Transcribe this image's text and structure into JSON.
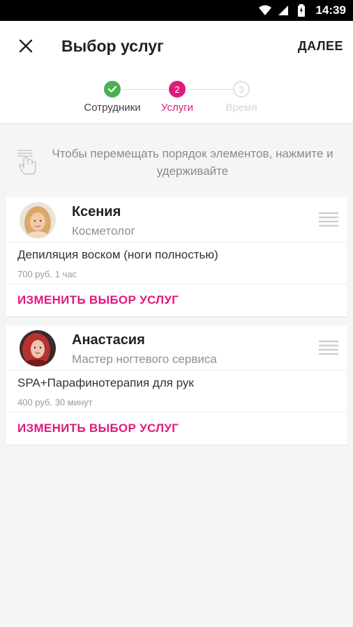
{
  "status_bar": {
    "time": "14:39",
    "icons": [
      "wifi-icon",
      "signal-icon",
      "battery-icon"
    ]
  },
  "app_bar": {
    "title": "Выбор услуг",
    "next_label": "ДАЛЕЕ",
    "close_icon": "close-icon"
  },
  "stepper": {
    "steps": [
      {
        "number": "",
        "label": "Сотрудники",
        "state": "done"
      },
      {
        "number": "2",
        "label": "Услуги",
        "state": "active"
      },
      {
        "number": "3",
        "label": "Время",
        "state": "pending"
      }
    ]
  },
  "hint": {
    "text": "Чтобы перемещать порядок элементов, нажмите и удерживайте",
    "icon": "touch-hand-icon"
  },
  "cards": [
    {
      "name": "Ксения",
      "role": "Косметолог",
      "service": "Депиляция воском (ноги полностью)",
      "price": "700 руб.  1 час",
      "action": "ИЗМЕНИТЬ ВЫБОР УСЛУГ"
    },
    {
      "name": "Анастасия",
      "role": "Мастер ногтевого сервиса",
      "service": "SPA+Парафинотерапия для рук",
      "price": "400 руб.  30 минут",
      "action": "ИЗМЕНИТЬ ВЫБОР УСЛУГ"
    }
  ],
  "colors": {
    "accent": "#e0197d",
    "done": "#4caf50",
    "muted": "#8f8f8f"
  }
}
